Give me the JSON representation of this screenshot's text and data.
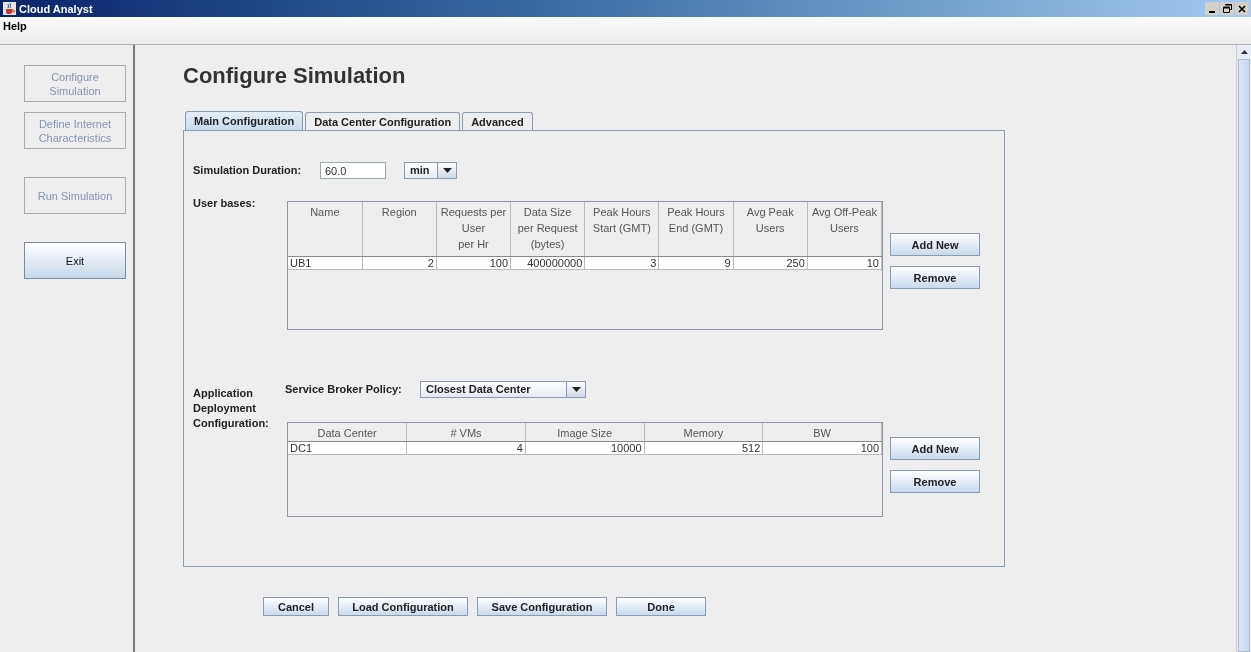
{
  "window": {
    "title": "Cloud Analyst"
  },
  "menu": [
    "Help"
  ],
  "sidebar": {
    "groups": [
      [
        {
          "label": "Configure\nSimulation",
          "disabled": true
        },
        {
          "label": "Define Internet\nCharacteristics",
          "disabled": true
        }
      ],
      [
        {
          "label": "Run Simulation",
          "disabled": true
        }
      ],
      [
        {
          "label": "Exit",
          "disabled": false
        }
      ]
    ]
  },
  "page_title": "Configure Simulation",
  "tabs": [
    {
      "label": "Main Configuration",
      "selected": true
    },
    {
      "label": "Data Center Configuration",
      "selected": false
    },
    {
      "label": "Advanced",
      "selected": false
    }
  ],
  "duration": {
    "label": "Simulation Duration:",
    "value": "60.0",
    "unit": "min"
  },
  "user_bases": {
    "label": "User bases:",
    "columns": [
      {
        "header": "Name",
        "kind": "text"
      },
      {
        "header": "Region",
        "kind": "number"
      },
      {
        "header": "Requests per\nUser\nper Hr",
        "kind": "number"
      },
      {
        "header": "Data Size\nper Request\n(bytes)",
        "kind": "number"
      },
      {
        "header": "Peak Hours\nStart (GMT)",
        "kind": "number"
      },
      {
        "header": "Peak Hours\nEnd (GMT)",
        "kind": "number"
      },
      {
        "header": "Avg Peak\nUsers",
        "kind": "number"
      },
      {
        "header": "Avg Off-Peak\nUsers",
        "kind": "number"
      }
    ],
    "rows": [
      [
        "UB1",
        "2",
        "100",
        "400000000",
        "3",
        "9",
        "250",
        "10"
      ]
    ],
    "buttons": [
      "Add New",
      "Remove"
    ]
  },
  "deployment": {
    "label": "Application\nDeployment\nConfiguration:",
    "policy": {
      "label": "Service Broker Policy:",
      "value": "Closest Data Center"
    },
    "columns": [
      {
        "header": "Data Center",
        "kind": "text"
      },
      {
        "header": "# VMs",
        "kind": "number"
      },
      {
        "header": "Image Size",
        "kind": "number"
      },
      {
        "header": "Memory",
        "kind": "number"
      },
      {
        "header": "BW",
        "kind": "number"
      }
    ],
    "rows": [
      [
        "DC1",
        "4",
        "10000",
        "512",
        "100"
      ]
    ],
    "buttons": [
      "Add New",
      "Remove"
    ]
  },
  "actions": [
    "Cancel",
    "Load Configuration",
    "Save Configuration",
    "Done"
  ]
}
